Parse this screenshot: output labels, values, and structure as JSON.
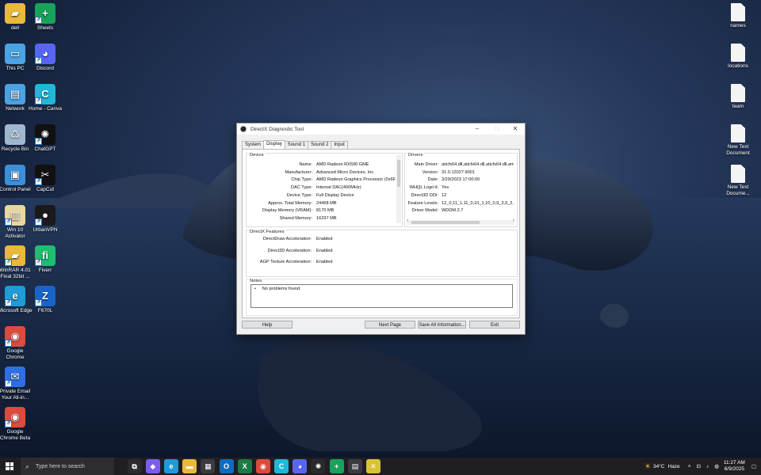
{
  "desktop_icons_left": [
    {
      "label": "dell",
      "icon": "folder-icon",
      "color": "#e8b93a"
    },
    {
      "label": "Sheets",
      "icon": "sheets-icon",
      "color": "#17a35c"
    },
    {
      "label": "This PC",
      "icon": "computer-icon",
      "color": "#4ba3e3"
    },
    {
      "label": "Discord",
      "icon": "discord-icon",
      "color": "#5865f2"
    },
    {
      "label": "Network",
      "icon": "network-icon",
      "color": "#4ba3e3"
    },
    {
      "label": "Home - Canva",
      "icon": "canva-icon",
      "color": "#1fb8d8"
    },
    {
      "label": "Recycle Bin",
      "icon": "recycle-bin-icon",
      "color": "#9fb8cf"
    },
    {
      "label": "ChatGPT",
      "icon": "chatgpt-icon",
      "color": "#111111"
    },
    {
      "label": "Control Panel",
      "icon": "control-panel-icon",
      "color": "#3c8fd8"
    },
    {
      "label": "CapCut",
      "icon": "capcut-icon",
      "color": "#111111"
    },
    {
      "label": "Win 10 Activator",
      "icon": "activator-icon",
      "color": "#e8d7a0"
    },
    {
      "label": "UrbanVPN",
      "icon": "urbanvpn-icon",
      "color": "#1a1a1a"
    },
    {
      "label": "WinRAR 4.01 Final 32bit ...",
      "icon": "winrar-folder-icon",
      "color": "#e8b93a"
    },
    {
      "label": "Fiverr",
      "icon": "fiverr-icon",
      "color": "#1dbf73"
    },
    {
      "label": "Microsoft Edge",
      "icon": "edge-icon",
      "color": "#1f9bd7"
    },
    {
      "label": "F670L",
      "icon": "zte-icon",
      "color": "#1a63c9"
    },
    {
      "label": "Google Chrome",
      "icon": "chrome-icon",
      "color": "#dd4b3e"
    },
    {
      "label": "Private Email Your All-in...",
      "icon": "email-icon",
      "color": "#2f6fe4"
    },
    {
      "label": "Google Chrome Beta",
      "icon": "chrome-beta-icon",
      "color": "#dd4b3e"
    }
  ],
  "desktop_icons_right": [
    {
      "label": "names"
    },
    {
      "label": "locations"
    },
    {
      "label": "team"
    },
    {
      "label": "New Text Document"
    },
    {
      "label": "New Text Docume..."
    }
  ],
  "window": {
    "title": "DirectX Diagnostic Tool",
    "tabs": [
      "System",
      "Display",
      "Sound 1",
      "Sound 2",
      "Input"
    ],
    "active_tab": "Display",
    "device": {
      "heading": "Device",
      "rows": [
        {
          "label": "Name:",
          "value": "AMD Radeon RX590 GME"
        },
        {
          "label": "Manufacturer:",
          "value": "Advanced Micro Devices, Inc."
        },
        {
          "label": "Chip Type:",
          "value": "AMD Radeon Graphics Processor (0x6FDF)"
        },
        {
          "label": "DAC Type:",
          "value": "Internal DAC(400MHz)"
        },
        {
          "label": "Device Type:",
          "value": "Full Display Device"
        },
        {
          "label": "Approx. Total Memory:",
          "value": "24468 MB"
        },
        {
          "label": "Display Memory (VRAM):",
          "value": "8170 MB"
        },
        {
          "label": "Shared Memory:",
          "value": "16297 MB"
        }
      ]
    },
    "drivers": {
      "heading": "Drivers",
      "rows": [
        {
          "label": "Main Driver:",
          "value": "aticfx64.dll,aticfx64.dll,aticfx64.dll,am"
        },
        {
          "label": "Version:",
          "value": "31.0.12027.9001"
        },
        {
          "label": "Date:",
          "value": "3/29/2023 17:00:00"
        },
        {
          "label": "WHQL Logo'd:",
          "value": "Yes"
        },
        {
          "label": "Direct3D DDI:",
          "value": "12"
        },
        {
          "label": "Feature Levels:",
          "value": "12_0,11_1,11_0,10_1,10_0,9_3,9_2,"
        },
        {
          "label": "Driver Model:",
          "value": "WDDM 2.7"
        }
      ]
    },
    "features": {
      "heading": "DirectX Features",
      "rows": [
        {
          "label": "DirectDraw Acceleration:",
          "value": "Enabled"
        },
        {
          "label": "Direct3D Acceleration:",
          "value": "Enabled"
        },
        {
          "label": "AGP Texture Acceleration:",
          "value": "Enabled"
        }
      ]
    },
    "notes": {
      "heading": "Notes",
      "items": [
        "No problems found."
      ]
    },
    "buttons": {
      "help": "Help",
      "next": "Next Page",
      "save": "Save All Information...",
      "exit": "Exit"
    }
  },
  "taskbar": {
    "search_placeholder": "Type here to search",
    "apps": [
      {
        "icon": "task-view-icon",
        "color": "#2a2a2e",
        "glyph": "⧉"
      },
      {
        "icon": "copilot-icon",
        "color": "#7b5cf0",
        "glyph": "◆"
      },
      {
        "icon": "edge-icon",
        "color": "#1f9bd7",
        "glyph": "e"
      },
      {
        "icon": "file-explorer-icon",
        "color": "#e8b93a",
        "glyph": "▬"
      },
      {
        "icon": "store-icon",
        "color": "#3a3a40",
        "glyph": "▦"
      },
      {
        "icon": "outlook-icon",
        "color": "#0f6cbd",
        "glyph": "O"
      },
      {
        "icon": "excel-icon",
        "color": "#1d7a45",
        "glyph": "X"
      },
      {
        "icon": "chrome-icon",
        "color": "#dd4b3e",
        "glyph": "◉"
      },
      {
        "icon": "canva-icon",
        "color": "#1fb8d8",
        "glyph": "C"
      },
      {
        "icon": "discord-icon",
        "color": "#5865f2",
        "glyph": "◕"
      },
      {
        "icon": "chatgpt-icon",
        "color": "#2a2a2e",
        "glyph": "✺"
      },
      {
        "icon": "sheets-icon",
        "color": "#17a35c",
        "glyph": "+"
      },
      {
        "icon": "calculator-icon",
        "color": "#3a3a40",
        "glyph": "▤"
      },
      {
        "icon": "dxdiag-icon",
        "color": "#d8c23a",
        "glyph": "✕"
      }
    ],
    "weather": {
      "temp": "34°C",
      "condition": "Haze"
    },
    "time": "11:27 AM",
    "date": "6/9/2025"
  }
}
